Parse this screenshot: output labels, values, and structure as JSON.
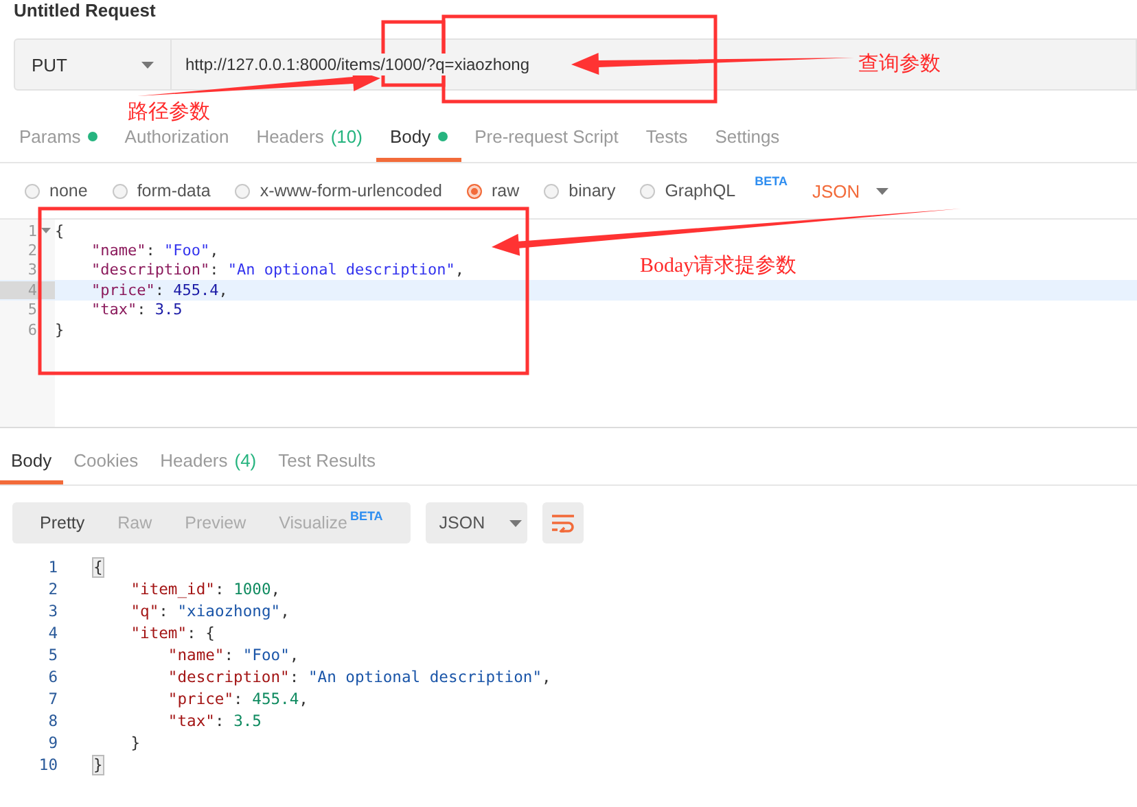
{
  "window": {
    "title": "Untitled Request"
  },
  "request": {
    "method": "PUT",
    "url": "http://127.0.0.1:8000/items/1000/?q=xiaozhong"
  },
  "request_tabs": [
    {
      "label": "Params",
      "indicator": true,
      "selected": false
    },
    {
      "label": "Authorization",
      "indicator": false,
      "selected": false
    },
    {
      "label": "Headers",
      "count": "(10)",
      "indicator": false,
      "selected": false
    },
    {
      "label": "Body",
      "indicator": true,
      "selected": true
    },
    {
      "label": "Pre-request Script",
      "indicator": false,
      "selected": false
    },
    {
      "label": "Tests",
      "indicator": false,
      "selected": false
    },
    {
      "label": "Settings",
      "indicator": false,
      "selected": false
    }
  ],
  "body_types": [
    {
      "label": "none",
      "selected": false
    },
    {
      "label": "form-data",
      "selected": false
    },
    {
      "label": "x-www-form-urlencoded",
      "selected": false
    },
    {
      "label": "raw",
      "selected": true
    },
    {
      "label": "binary",
      "selected": false
    },
    {
      "label": "GraphQL",
      "badge": "BETA",
      "selected": false
    }
  ],
  "body_format": "JSON",
  "request_editor": {
    "kind": "request",
    "lines": [
      {
        "number": "1",
        "text": "{",
        "foldable": true,
        "highlighted": false
      },
      {
        "number": "2",
        "text": "    \"name\": \"Foo\",",
        "foldable": false,
        "highlighted": false
      },
      {
        "number": "3",
        "text": "    \"description\": \"An optional description\",",
        "foldable": false,
        "highlighted": false
      },
      {
        "number": "4",
        "text": "    \"price\": 455.4,",
        "foldable": false,
        "highlighted": true
      },
      {
        "number": "5",
        "text": "    \"tax\": 3.5",
        "foldable": false,
        "highlighted": false
      },
      {
        "number": "6",
        "text": "}",
        "foldable": false,
        "highlighted": false
      }
    ]
  },
  "response_tabs": [
    {
      "label": "Body",
      "selected": true
    },
    {
      "label": "Cookies",
      "selected": false
    },
    {
      "label": "Headers",
      "count": "(4)",
      "selected": false
    },
    {
      "label": "Test Results",
      "selected": false
    }
  ],
  "view_modes": [
    {
      "label": "Pretty",
      "selected": true
    },
    {
      "label": "Raw",
      "selected": false
    },
    {
      "label": "Preview",
      "selected": false
    },
    {
      "label": "Visualize",
      "badge": "BETA",
      "selected": false
    }
  ],
  "response_format": "JSON",
  "response_editor": {
    "kind": "response",
    "lines": [
      {
        "number": "1",
        "text": "{",
        "bracket_match": true
      },
      {
        "number": "2",
        "text": "    \"item_id\": 1000,",
        "bracket_match": false
      },
      {
        "number": "3",
        "text": "    \"q\": \"xiaozhong\",",
        "bracket_match": false
      },
      {
        "number": "4",
        "text": "    \"item\": {",
        "bracket_match": false
      },
      {
        "number": "5",
        "text": "        \"name\": \"Foo\",",
        "bracket_match": false
      },
      {
        "number": "6",
        "text": "        \"description\": \"An optional description\",",
        "bracket_match": false
      },
      {
        "number": "7",
        "text": "        \"price\": 455.4,",
        "bracket_match": false
      },
      {
        "number": "8",
        "text": "        \"tax\": 3.5",
        "bracket_match": false
      },
      {
        "number": "9",
        "text": "    }",
        "bracket_match": false
      },
      {
        "number": "10",
        "text": "}",
        "bracket_match": true
      }
    ]
  },
  "annotations": [
    {
      "kind": "path",
      "text": "路径参数"
    },
    {
      "kind": "query",
      "text": "查询参数"
    },
    {
      "kind": "body",
      "text": "Boday请求提参数"
    }
  ]
}
